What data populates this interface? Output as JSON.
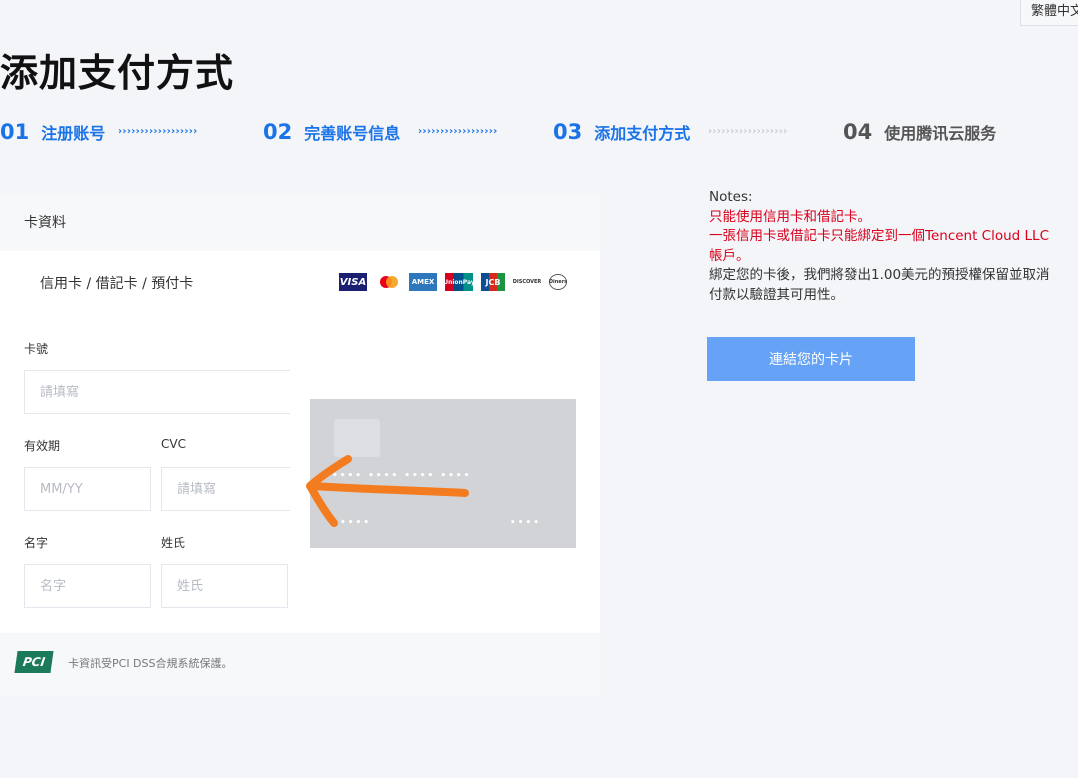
{
  "language": {
    "label": "繁體中文"
  },
  "page_title": "添加支付方式",
  "steps": [
    {
      "num": "01",
      "label": "注册账号",
      "state": "done"
    },
    {
      "num": "02",
      "label": "完善账号信息",
      "state": "done"
    },
    {
      "num": "03",
      "label": "添加支付方式",
      "state": "active"
    },
    {
      "num": "04",
      "label": "使用腾讯云服务",
      "state": "future"
    }
  ],
  "card_panel": {
    "heading": "卡資料",
    "card_types": "信用卡 / 借記卡 / 預付卡",
    "brands": [
      {
        "name": "visa-logo",
        "text": "VISA"
      },
      {
        "name": "mastercard-logo",
        "text": ""
      },
      {
        "name": "amex-logo",
        "text": "AMEX"
      },
      {
        "name": "unionpay-logo",
        "text": "UnionPay"
      },
      {
        "name": "jcb-logo",
        "text": "JCB"
      },
      {
        "name": "discover-logo",
        "text": "DISCOVER"
      },
      {
        "name": "diners-logo",
        "text": "Diners"
      }
    ],
    "card_number": {
      "label": "卡號",
      "placeholder": "請填寫",
      "value": ""
    },
    "expiry": {
      "label": "有效期",
      "placeholder": "MM/YY",
      "value": ""
    },
    "cvc": {
      "label": "CVC",
      "placeholder": "請填寫",
      "value": ""
    },
    "first_name": {
      "label": "名字",
      "placeholder": "名字",
      "value": ""
    },
    "last_name": {
      "label": "姓氏",
      "placeholder": "姓氏",
      "value": ""
    },
    "card_preview": {
      "number_dots": "•••• •••• •••• ••••",
      "name_dots": "••••",
      "expiry_dots": "••••"
    },
    "security_note": "卡資訊受PCI DSS合規系統保護。",
    "pci_logo": "PCI"
  },
  "notes": {
    "title": "Notes:",
    "lines_red": [
      "只能使用信用卡和借記卡。",
      "一張信用卡或借記卡只能綁定到一個Tencent Cloud LLC帳戶。"
    ],
    "line_normal": "綁定您的卡後，我們將發出1.00美元的預授權保留並取消付款以驗證其可用性。"
  },
  "link_button": "連結您的卡片",
  "colors": {
    "accent": "#1a73e8",
    "button": "#66a3f7",
    "warning": "#d9001b",
    "annotation": "#f47c20"
  }
}
